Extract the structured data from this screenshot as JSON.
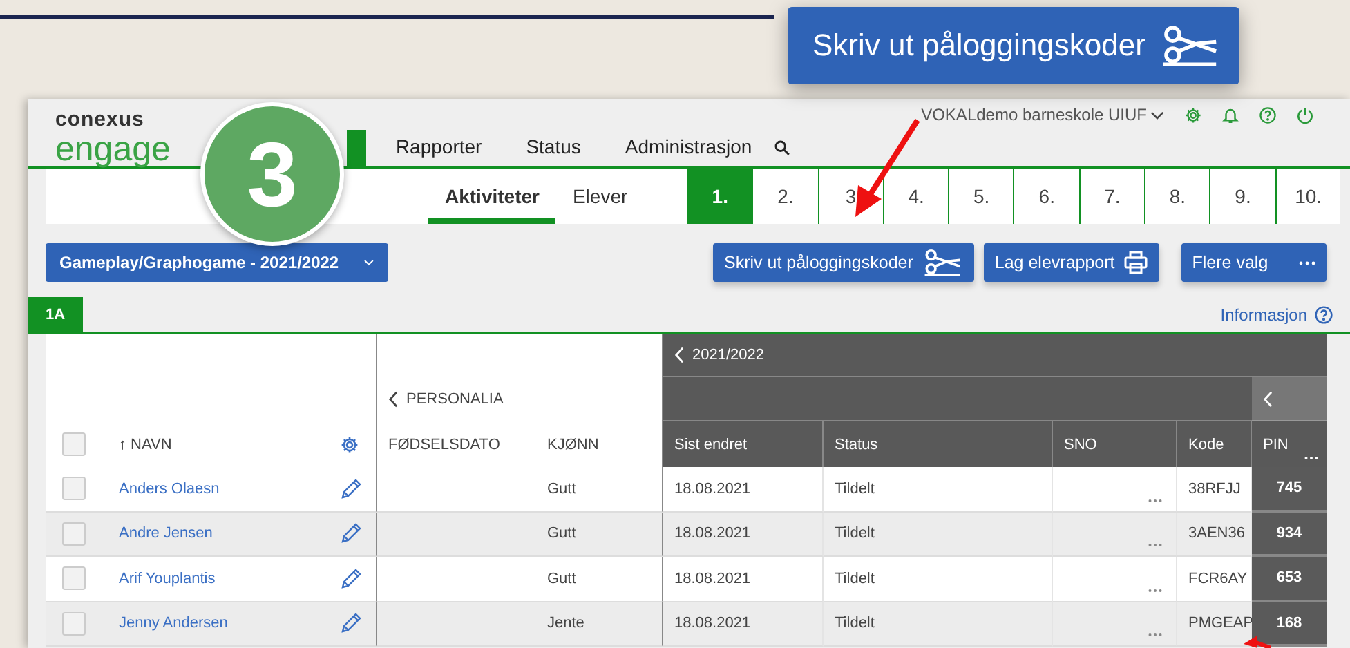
{
  "callout": {
    "label": "Skriv ut påloggingskoder"
  },
  "step_badge": {
    "label": "3"
  },
  "header": {
    "logo_top": "conexus",
    "logo_bottom": "engage",
    "school": "VOKALdemo barneskole UIUF",
    "nav": [
      {
        "selected": true
      },
      {
        "label": "Rapporter",
        "selected": false
      },
      {
        "label": "Status",
        "selected": false
      },
      {
        "label": "Administrasjon",
        "selected": false
      }
    ]
  },
  "subnav": {
    "views": [
      {
        "label": "Aktiviteter",
        "selected": true
      },
      {
        "label": "Elever",
        "selected": false
      }
    ],
    "steps": [
      {
        "label": "1.",
        "selected": true
      },
      {
        "label": "2.",
        "selected": false
      },
      {
        "label": "3",
        "selected": false
      },
      {
        "label": "4.",
        "selected": false
      },
      {
        "label": "5.",
        "selected": false
      },
      {
        "label": "6.",
        "selected": false
      },
      {
        "label": "7.",
        "selected": false
      },
      {
        "label": "8.",
        "selected": false
      },
      {
        "label": "9.",
        "selected": false
      },
      {
        "label": "10.",
        "selected": false
      }
    ]
  },
  "toolbar": {
    "activity": "Gameplay/Graphogame - 2021/2022",
    "buttons": [
      {
        "label": "Skriv ut påloggingskoder",
        "kind": "print-codes"
      },
      {
        "label": "Lag elevrapport",
        "kind": "report"
      },
      {
        "label": "Flere valg",
        "kind": "more"
      }
    ]
  },
  "class_tabs": [
    {
      "label": "1A",
      "selected": true
    }
  ],
  "info_link": "Informasjon",
  "table": {
    "group": "2021/2022",
    "section": "PERSONALIA",
    "all_checked": false,
    "columns": [
      "↑ NAVN",
      "FØDSELSDATO",
      "KJØNN",
      "Sist endret",
      "Status",
      "SNO",
      "Kode",
      "PIN"
    ],
    "rows": [
      {
        "name": "Anders Olaesn",
        "gender": "Gutt",
        "changed": "18.08.2021",
        "status": "Tildelt",
        "code": "38RFJJ",
        "pin": "745",
        "checked": false
      },
      {
        "name": "Andre Jensen",
        "gender": "Gutt",
        "changed": "18.08.2021",
        "status": "Tildelt",
        "code": "3AEN36",
        "pin": "934",
        "checked": false
      },
      {
        "name": "Arif Youplantis",
        "gender": "Gutt",
        "changed": "18.08.2021",
        "status": "Tildelt",
        "code": "FCR6AY",
        "pin": "653",
        "checked": false
      },
      {
        "name": "Jenny Andersen",
        "gender": "Jente",
        "changed": "18.08.2021",
        "status": "Tildelt",
        "code": "PMGEAP",
        "pin": "168",
        "checked": false
      }
    ]
  }
}
